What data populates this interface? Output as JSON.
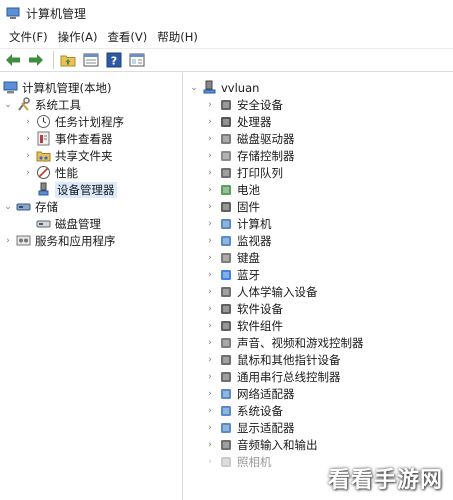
{
  "window": {
    "title": "计算机管理"
  },
  "menu": [
    "文件(F)",
    "操作(A)",
    "查看(V)",
    "帮助(H)"
  ],
  "toolbar": [
    "back-arrow-icon",
    "forward-arrow-icon",
    "up-folder-icon",
    "properties-icon",
    "help-icon",
    "show-pane-icon"
  ],
  "tree": {
    "root": "计算机管理(本地)",
    "system_tools": "系统工具",
    "task_scheduler": "任务计划程序",
    "event_viewer": "事件查看器",
    "shared_folders": "共享文件夹",
    "performance": "性能",
    "device_manager": "设备管理器",
    "storage": "存储",
    "disk_management": "磁盘管理",
    "services_apps": "服务和应用程序"
  },
  "devices": {
    "computer_name": "vvluan",
    "categories": [
      "安全设备",
      "处理器",
      "磁盘驱动器",
      "存储控制器",
      "打印队列",
      "电池",
      "固件",
      "计算机",
      "监视器",
      "键盘",
      "蓝牙",
      "人体学输入设备",
      "软件设备",
      "软件组件",
      "声音、视频和游戏控制器",
      "鼠标和其他指针设备",
      "通用串行总线控制器",
      "网络适配器",
      "系统设备",
      "显示适配器",
      "音频输入和输出",
      "照相机"
    ]
  },
  "watermark": "看看手游网",
  "colors": {
    "selection": "#dcebfc",
    "arrow_green": "#3e8e3e",
    "pane_border": "#d7d7d7"
  }
}
